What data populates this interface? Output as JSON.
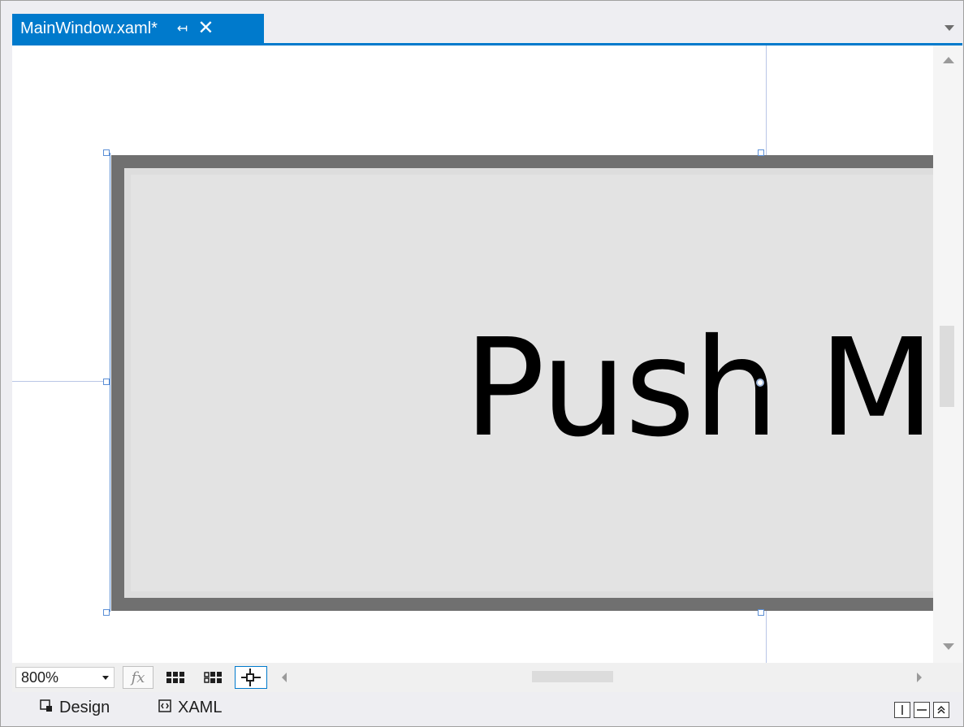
{
  "document_tab": {
    "title": "MainWindow.xaml*",
    "pin_glyph": "↧",
    "close_glyph": "✕"
  },
  "canvas": {
    "button_content": "Push M"
  },
  "toolbar": {
    "zoom_value": "800%"
  },
  "view_tabs": {
    "design_label": "Design",
    "xaml_label": "XAML"
  },
  "icons": {
    "pin": "pin-icon",
    "close": "close-icon",
    "fx": "fx-icon",
    "grid": "grid-icon",
    "snap_grid": "snap-to-grid-icon",
    "snap_lines": "snap-to-snaplines-icon",
    "design": "design-view-icon",
    "xaml": "xaml-view-icon"
  },
  "colors": {
    "accent": "#007acc",
    "button_border": "#707070",
    "button_face": "#dddddd",
    "guides": "#b9c6e6",
    "selection": "#5b8fd6"
  }
}
